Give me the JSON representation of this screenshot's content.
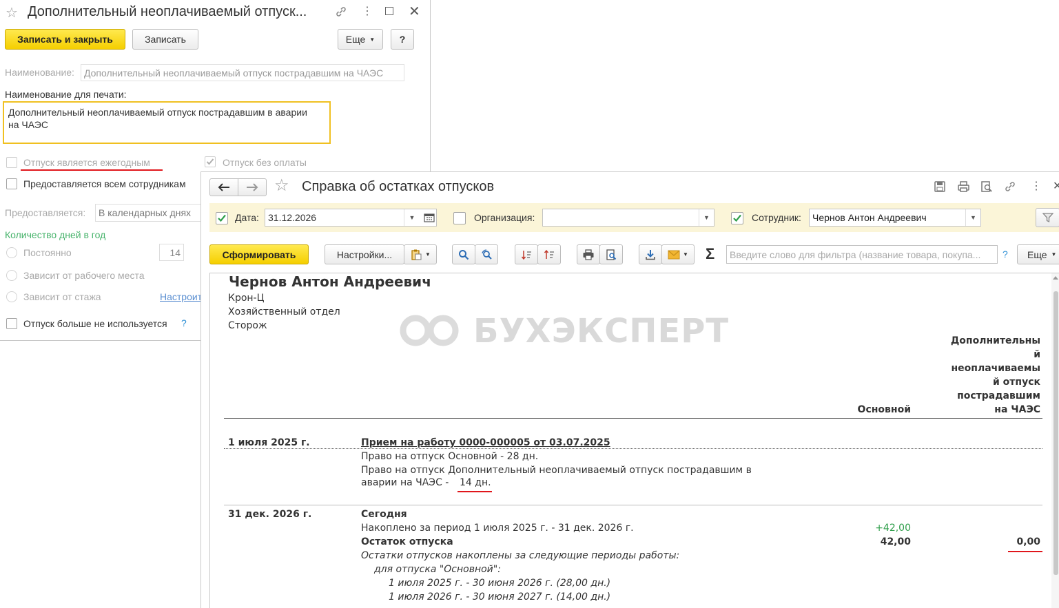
{
  "left_form": {
    "title": "Дополнительный неоплачиваемый отпуск...",
    "btn_save_close": "Записать и закрыть",
    "btn_save": "Записать",
    "btn_more": "Еще",
    "btn_help": "?",
    "name_label": "Наименование:",
    "name_value": "Дополнительный неоплачиваемый отпуск пострадавшим на ЧАЭС",
    "print_name_label": "Наименование для печати:",
    "print_name_line1": "Дополнительный неоплачиваемый отпуск пострадавшим в аварии",
    "print_name_line2": "на ЧАЭС",
    "chk_annual": "Отпуск является ежегодным",
    "chk_unpaid": "Отпуск без оплаты",
    "chk_all_employees": "Предоставляется всем сотрудникам",
    "provided_label": "Предоставляется:",
    "provided_value": "В календарных днях",
    "days_per_year_label": "Количество дней в год",
    "radio_constant": "Постоянно",
    "days_value": "14",
    "radio_workplace": "Зависит от рабочего места",
    "radio_seniority": "Зависит от стажа",
    "setup_link": "Настроить",
    "chk_not_used": "Отпуск больше не используется",
    "help_q": "?"
  },
  "report": {
    "title": "Справка об остатках отпусков",
    "date_label": "Дата:",
    "date_value": "31.12.2026",
    "org_label": "Организация:",
    "org_value": "",
    "employee_label": "Сотрудник:",
    "employee_value": "Чернов Антон Андреевич",
    "btn_generate": "Сформировать",
    "btn_settings": "Настройки...",
    "search_placeholder": "Введите слово для фильтра (название товара, покупа...",
    "help_q": "?",
    "btn_more": "Еще",
    "watermark": "БУХЭКСПЕРТ",
    "content": {
      "emp_name": "Чернов Антон Андреевич",
      "org": "Крон-Ц",
      "dept": "Хозяйственный отдел",
      "position": "Сторож",
      "col_main": "Основной",
      "col_extra_lines": [
        "Дополнительны",
        "й",
        "неоплачиваемы",
        "й отпуск",
        "пострадавшим",
        "на ЧАЭС"
      ],
      "row1_date": "1 июля 2025 г.",
      "row1_doc": "Прием на работу 0000-000005 от 03.07.2025",
      "row1_line1": "Право на отпуск Основной - 28 дн.",
      "row1_line2": "Право на отпуск Дополнительный неоплачиваемый отпуск пострадавшим в",
      "row1_line3a": "аварии на ЧАЭС -",
      "row1_line3b": "14 дн.",
      "row2_date": "31 дек. 2026 г.",
      "row2_today": "Сегодня",
      "row2_accum": "Накоплено за период 1 июля 2025 г. - 31 дек. 2026 г.",
      "row2_accum_val": "+42,00",
      "row2_balance": "Остаток отпуска",
      "row2_balance_main": "42,00",
      "row2_balance_extra": "0,00",
      "row2_note": "Остатки отпусков накоплены за следующие периоды работы:",
      "row2_for_main": "для отпуска \"Основной\":",
      "row2_period1": "1 июля 2025 г. - 30 июня 2026 г. (28,00 дн.)",
      "row2_period2": "1 июля 2026 г. - 30 июня 2027 г. (14,00 дн.)"
    }
  },
  "colors": {
    "accent_yellow": "#f5cf00",
    "highlight_border": "#f0c020",
    "green": "#2e9e4a",
    "red_mark": "#e0161b"
  }
}
